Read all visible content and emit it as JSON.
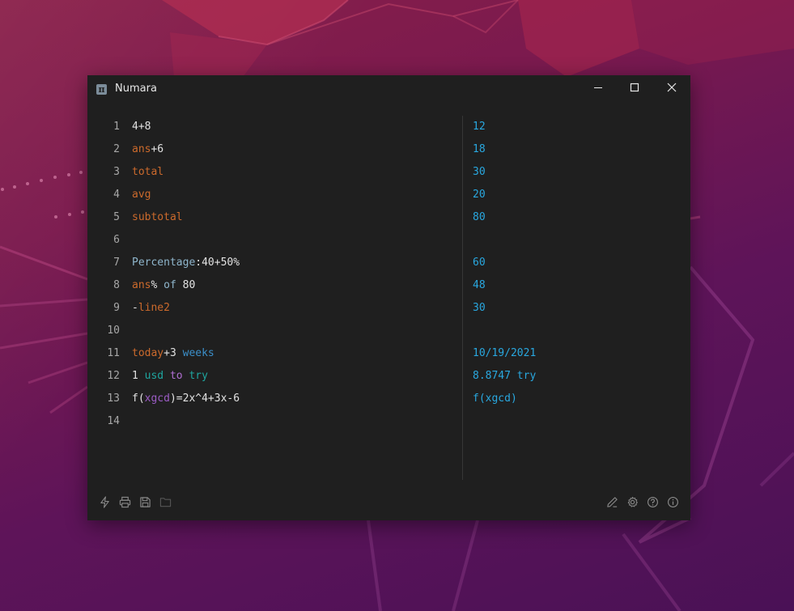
{
  "window": {
    "title": "Numara"
  },
  "lines": [
    {
      "num": "1",
      "tokens": [
        {
          "text": "4+8",
          "type": "plain"
        }
      ]
    },
    {
      "num": "2",
      "tokens": [
        {
          "text": "ans",
          "type": "var"
        },
        {
          "text": "+6",
          "type": "plain"
        }
      ]
    },
    {
      "num": "3",
      "tokens": [
        {
          "text": "total",
          "type": "var"
        }
      ]
    },
    {
      "num": "4",
      "tokens": [
        {
          "text": "avg",
          "type": "var"
        }
      ]
    },
    {
      "num": "5",
      "tokens": [
        {
          "text": "subtotal",
          "type": "var"
        }
      ]
    },
    {
      "num": "6",
      "tokens": []
    },
    {
      "num": "7",
      "tokens": [
        {
          "text": "Percentage",
          "type": "kw"
        },
        {
          "text": ":40+50%",
          "type": "plain"
        }
      ]
    },
    {
      "num": "8",
      "tokens": [
        {
          "text": "ans",
          "type": "var"
        },
        {
          "text": "% ",
          "type": "plain"
        },
        {
          "text": "of",
          "type": "kw"
        },
        {
          "text": " 80",
          "type": "plain"
        }
      ]
    },
    {
      "num": "9",
      "tokens": [
        {
          "text": "-",
          "type": "plain"
        },
        {
          "text": "line2",
          "type": "var"
        }
      ]
    },
    {
      "num": "10",
      "tokens": []
    },
    {
      "num": "11",
      "tokens": [
        {
          "text": "today",
          "type": "var"
        },
        {
          "text": "+3 ",
          "type": "plain"
        },
        {
          "text": "weeks",
          "type": "unit"
        }
      ]
    },
    {
      "num": "12",
      "tokens": [
        {
          "text": "1 ",
          "type": "plain"
        },
        {
          "text": "usd",
          "type": "cur"
        },
        {
          "text": " ",
          "type": "plain"
        },
        {
          "text": "to",
          "type": "op"
        },
        {
          "text": " ",
          "type": "plain"
        },
        {
          "text": "try",
          "type": "cur"
        }
      ]
    },
    {
      "num": "13",
      "tokens": [
        {
          "text": "f(",
          "type": "plain"
        },
        {
          "text": "xgcd",
          "type": "fn"
        },
        {
          "text": ")=2x^4+3x-6",
          "type": "plain"
        }
      ]
    },
    {
      "num": "14",
      "tokens": []
    }
  ],
  "results": [
    "12",
    "18",
    "30",
    "20",
    "80",
    "",
    "60",
    "48",
    "30",
    "",
    "10/19/2021",
    "8.8747 try",
    "f(xgcd)",
    ""
  ],
  "colors": {
    "variable": "#cc6a2c",
    "keyword": "#8fb6cc",
    "unit": "#3b8fc9",
    "currency": "#1fa6a0",
    "operator": "#b06fd3",
    "result": "#29a8e0",
    "window_bg": "#1f1f1f"
  },
  "footer": {
    "left_icons": [
      "lightning-icon",
      "print-icon",
      "save-icon",
      "folder-icon"
    ],
    "right_icons": [
      "pencil-icon",
      "gear-icon",
      "help-icon",
      "info-icon"
    ]
  }
}
